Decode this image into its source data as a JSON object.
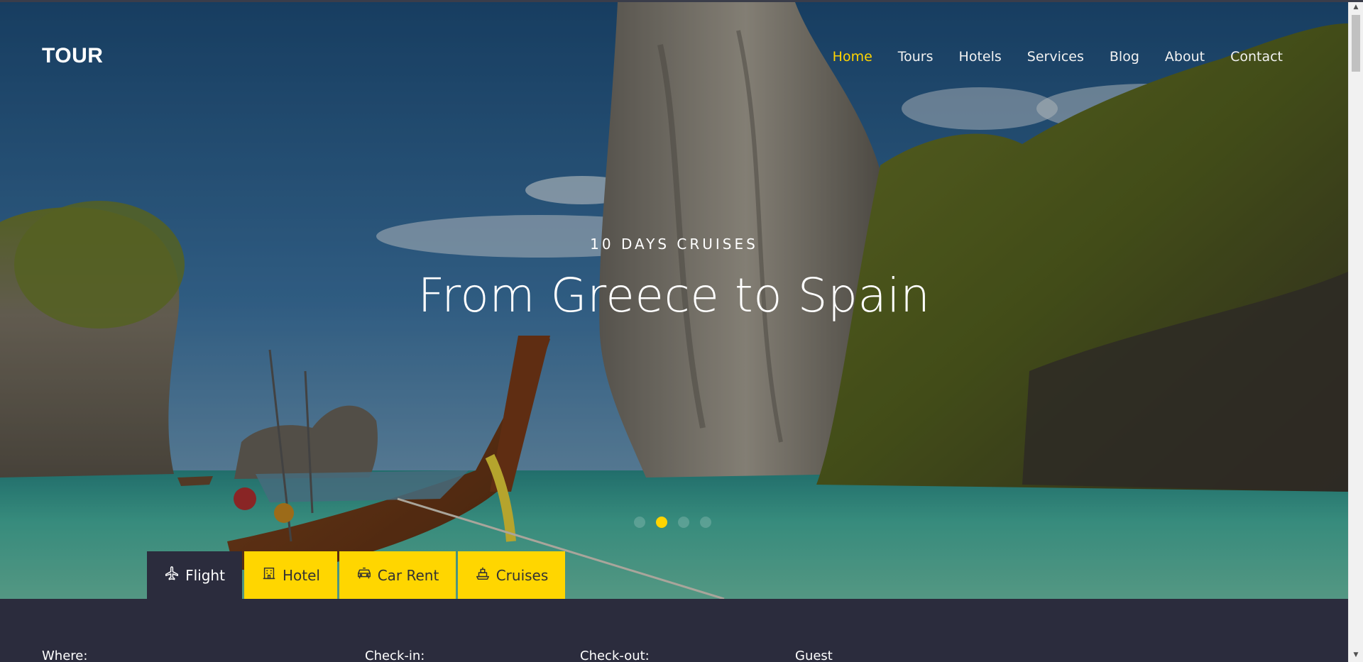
{
  "brand": {
    "logo_text": "TOUR"
  },
  "nav": {
    "items": [
      {
        "label": "Home",
        "active": true
      },
      {
        "label": "Tours"
      },
      {
        "label": "Hotels"
      },
      {
        "label": "Services"
      },
      {
        "label": "Blog"
      },
      {
        "label": "About"
      },
      {
        "label": "Contact"
      }
    ]
  },
  "hero": {
    "subtitle": "10 DAYS CRUISES",
    "title": "From Greece to Spain",
    "slides": {
      "count": 4,
      "active_index": 1
    }
  },
  "search_tabs": [
    {
      "label": "Flight",
      "icon": "airplane-icon",
      "active": true
    },
    {
      "label": "Hotel",
      "icon": "hotel-icon"
    },
    {
      "label": "Car Rent",
      "icon": "car-icon"
    },
    {
      "label": "Cruises",
      "icon": "ship-icon"
    }
  ],
  "search_form": {
    "where_label": "Where:",
    "checkin_label": "Check-in:",
    "checkout_label": "Check-out:",
    "guest_label": "Guest"
  },
  "colors": {
    "accent": "#ffd400",
    "tab_bg": "#ffd600",
    "panel_bg": "#2b2c3d"
  }
}
